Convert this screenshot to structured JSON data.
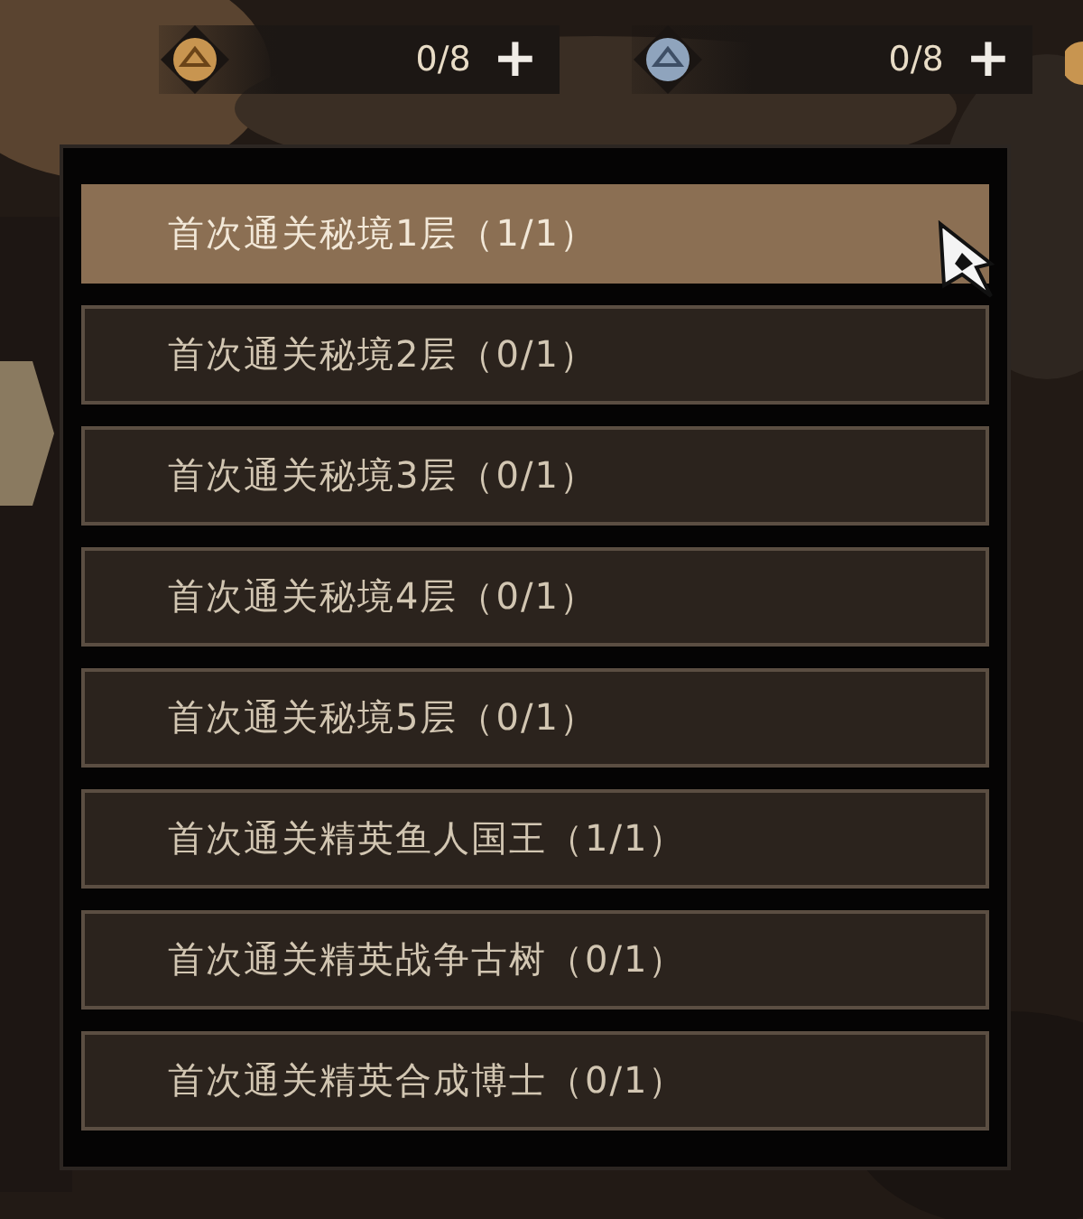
{
  "currencies": [
    {
      "kind": "gold",
      "count": "0/8",
      "plus": "+"
    },
    {
      "kind": "silver",
      "count": "0/8",
      "plus": "+"
    }
  ],
  "quests": [
    {
      "label": "首次通关秘境1层（1/1）",
      "selected": true
    },
    {
      "label": "首次通关秘境2层（0/1）",
      "selected": false
    },
    {
      "label": "首次通关秘境3层（0/1）",
      "selected": false
    },
    {
      "label": "首次通关秘境4层（0/1）",
      "selected": false
    },
    {
      "label": "首次通关秘境5层（0/1）",
      "selected": false
    },
    {
      "label": "首次通关精英鱼人国王（1/1）",
      "selected": false
    },
    {
      "label": "首次通关精英战争古树（0/1）",
      "selected": false
    },
    {
      "label": "首次通关精英合成博士（0/1）",
      "selected": false
    }
  ]
}
